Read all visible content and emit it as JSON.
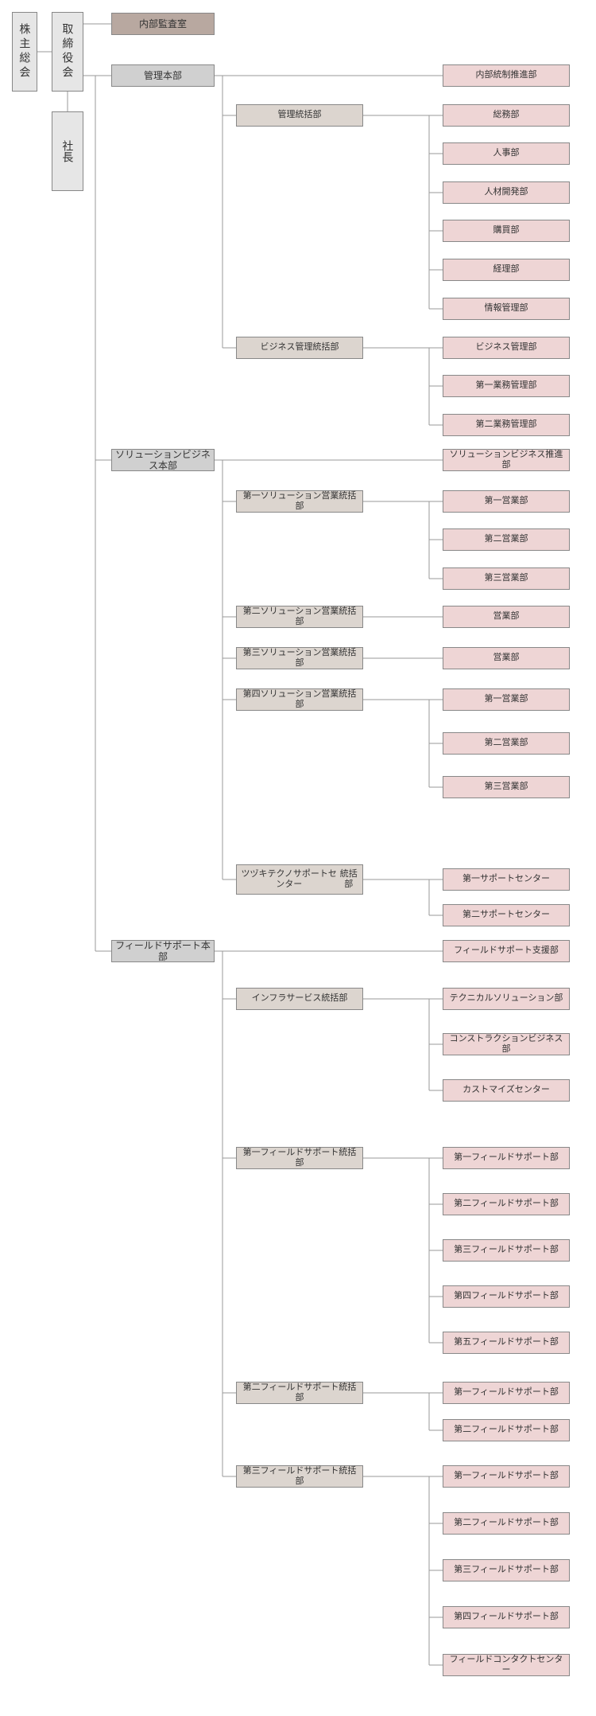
{
  "top": {
    "shareholders": "株主総会",
    "board": "取締役会",
    "president_l1": "社",
    "president_l2": "長",
    "audit": "内部監査室"
  },
  "hq": {
    "admin": "管理本部",
    "solution": "ソリューションビジネス本部",
    "field": "フィールドサポート本部"
  },
  "div": {
    "admin_gen": "管理統括部",
    "biz_admin": "ビジネス管理統括部",
    "sol1": "第一ソリューション営業統括部",
    "sol2": "第二ソリューション営業統括部",
    "sol3": "第三ソリューション営業統括部",
    "sol4": "第四ソリューション営業統括部",
    "tsuzuki_l1": "ツヅキテクノサポートセンター",
    "tsuzuki_l2": "統括部",
    "infra": "インフラサービス統括部",
    "fs1": "第一フィールドサポート統括部",
    "fs2": "第二フィールドサポート統括部",
    "fs3": "第三フィールドサポート統括部"
  },
  "leaf": {
    "intctrl": "内部統制推進部",
    "soumu": "総務部",
    "jinji": "人事部",
    "jinzai": "人材開発部",
    "koubai": "購買部",
    "keiri": "経理部",
    "jouhou": "情報管理部",
    "biz_mgmt": "ビジネス管理部",
    "gyomu1": "第一業務管理部",
    "gyomu2": "第二業務管理部",
    "sol_promo": "ソリューションビジネス推進部",
    "sales1": "第一営業部",
    "sales2": "第二営業部",
    "sales3": "第三営業部",
    "sales": "営業部",
    "sol4_sales1": "第一営業部",
    "sol4_sales2": "第二営業部",
    "sol4_sales3": "第三営業部",
    "support1": "第一サポートセンター",
    "support2": "第二サポートセンター",
    "fs_support": "フィールドサポート支援部",
    "tech_sol": "テクニカルソリューション部",
    "constr_biz": "コンストラクションビジネス部",
    "customize": "カストマイズセンター",
    "fs1_1": "第一フィールドサポート部",
    "fs1_2": "第二フィールドサポート部",
    "fs1_3": "第三フィールドサポート部",
    "fs1_4": "第四フィールドサポート部",
    "fs1_5": "第五フィールドサポート部",
    "fs2_1": "第一フィールドサポート部",
    "fs2_2": "第二フィールドサポート部",
    "fs3_1": "第一フィールドサポート部",
    "fs3_2": "第二フィールドサポート部",
    "fs3_3": "第三フィールドサポート部",
    "fs3_4": "第四フィールドサポート部",
    "contact": "フィールドコンタクトセンター"
  }
}
